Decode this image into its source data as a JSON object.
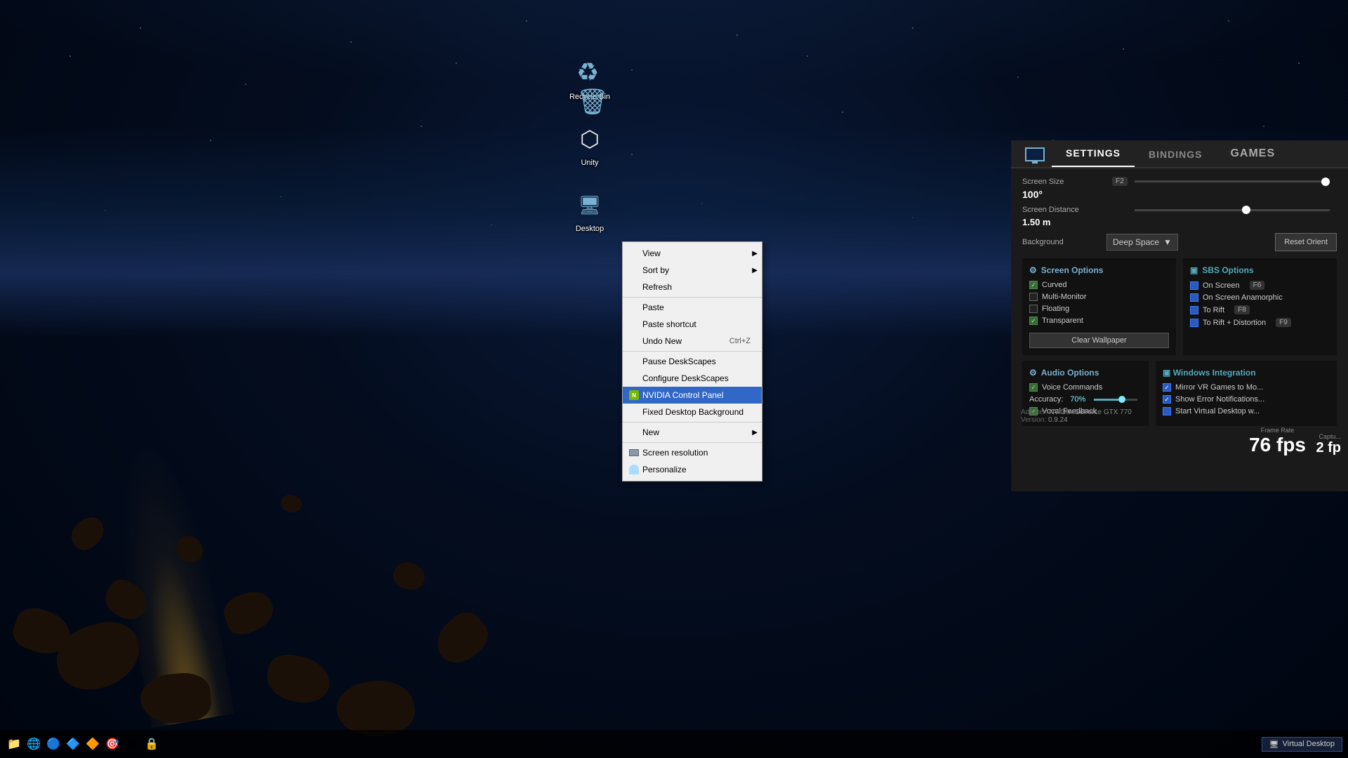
{
  "desktop": {
    "icons": [
      {
        "id": "recycle-bin",
        "label": "Recycle Bin",
        "type": "recycle"
      },
      {
        "id": "unity",
        "label": "Unity",
        "type": "unity"
      },
      {
        "id": "desktop2",
        "label": "Desktop",
        "type": "desktop2"
      }
    ]
  },
  "context_menu": {
    "items": [
      {
        "id": "view",
        "label": "View",
        "has_submenu": true,
        "separator_after": false,
        "highlighted": false,
        "has_icon": false
      },
      {
        "id": "sort-by",
        "label": "Sort by",
        "has_submenu": true,
        "separator_after": false,
        "highlighted": false,
        "has_icon": false
      },
      {
        "id": "refresh",
        "label": "Refresh",
        "has_submenu": false,
        "separator_after": true,
        "highlighted": false,
        "has_icon": false
      },
      {
        "id": "paste",
        "label": "Paste",
        "has_submenu": false,
        "separator_after": false,
        "highlighted": false,
        "has_icon": false
      },
      {
        "id": "paste-shortcut",
        "label": "Paste shortcut",
        "has_submenu": false,
        "separator_after": false,
        "highlighted": false,
        "has_icon": false
      },
      {
        "id": "undo-new",
        "label": "Undo New",
        "shortcut": "Ctrl+Z",
        "has_submenu": false,
        "separator_after": true,
        "highlighted": false,
        "has_icon": false
      },
      {
        "id": "pause-deskscapes",
        "label": "Pause DeskScapes",
        "has_submenu": false,
        "separator_after": false,
        "highlighted": false,
        "has_icon": false
      },
      {
        "id": "configure-deskscapes",
        "label": "Configure DeskScapes",
        "has_submenu": false,
        "separator_after": false,
        "highlighted": false,
        "has_icon": false
      },
      {
        "id": "nvidia-control-panel",
        "label": "NVIDIA Control Panel",
        "has_submenu": false,
        "separator_after": false,
        "highlighted": true,
        "has_icon": true,
        "icon_type": "nvidia"
      },
      {
        "id": "fixed-desktop-background",
        "label": "Fixed Desktop Background",
        "has_submenu": false,
        "separator_after": true,
        "highlighted": false,
        "has_icon": false
      },
      {
        "id": "new",
        "label": "New",
        "has_submenu": true,
        "separator_after": false,
        "highlighted": false,
        "has_icon": false
      },
      {
        "id": "screen-resolution",
        "label": "Screen resolution",
        "has_submenu": false,
        "separator_after": false,
        "highlighted": false,
        "has_icon": true,
        "icon_type": "screen"
      },
      {
        "id": "personalize",
        "label": "Personalize",
        "has_submenu": false,
        "separator_after": false,
        "highlighted": false,
        "has_icon": true,
        "icon_type": "person"
      }
    ]
  },
  "settings_panel": {
    "tabs": [
      {
        "id": "settings",
        "label": "SETTINGS",
        "active": true
      },
      {
        "id": "bindings",
        "label": "BINDINGS",
        "active": false
      },
      {
        "id": "games",
        "label": "GAMES",
        "active": false
      }
    ],
    "screen_size": {
      "label": "Screen Size",
      "fkey": "F2",
      "value": "100°"
    },
    "screen_distance": {
      "label": "Screen Distance",
      "value": "1.50 m"
    },
    "background": {
      "label": "Background",
      "value": "Deep Space"
    },
    "reset_orient_label": "Reset Orient",
    "screen_options": {
      "title": "Screen Options",
      "items": [
        {
          "id": "curved",
          "label": "Curved",
          "checked": true
        },
        {
          "id": "multi-monitor",
          "label": "Multi-Monitor",
          "checked": false
        },
        {
          "id": "floating",
          "label": "Floating",
          "checked": false
        },
        {
          "id": "transparent",
          "label": "Transparent",
          "checked": true
        }
      ],
      "clear_wallpaper_label": "Clear Wallpaper"
    },
    "sbs_options": {
      "title": "SBS Options",
      "items": [
        {
          "id": "on-screen",
          "label": "On Screen",
          "fkey": "F6",
          "checked": false
        },
        {
          "id": "on-screen-anamorphic",
          "label": "On Screen Anamorphic",
          "checked": false
        },
        {
          "id": "to-rift",
          "label": "To Rift",
          "fkey": "F8",
          "checked": false
        },
        {
          "id": "to-rift-distortion",
          "label": "To Rift + Distortion",
          "fkey": "F9",
          "checked": false
        }
      ]
    },
    "audio_options": {
      "title": "Audio Options",
      "items": [
        {
          "id": "voice-commands",
          "label": "Voice Commands",
          "checked": true
        },
        {
          "id": "accuracy",
          "label": "Accuracy:",
          "value": "70%",
          "is_slider": true
        },
        {
          "id": "vocal-feedback",
          "label": "Vocal Feedback",
          "checked": true
        }
      ]
    },
    "windows_integration": {
      "title": "Windows Integration",
      "items": [
        {
          "id": "mirror-vr",
          "label": "Mirror VR Games to Mo...",
          "checked": true
        },
        {
          "id": "show-errors",
          "label": "Show Error Notifications...",
          "checked": true
        },
        {
          "id": "start-virtual",
          "label": "Start Virtual Desktop w...",
          "checked": false
        }
      ]
    },
    "adapter": {
      "label": "Adapter:",
      "value": "NVIDIA GeForce GTX 770"
    },
    "version": {
      "label": "Version:",
      "value": "0.9.24"
    }
  },
  "fps_display": {
    "frame_rate_label": "Frame Rate",
    "fps_value": "76 fps",
    "capture_label": "Captu...",
    "capture_value": "2 fp"
  },
  "taskbar": {
    "programs": [
      {
        "id": "virtual-desktop",
        "label": "Virtual Desktop",
        "active": true
      }
    ]
  }
}
